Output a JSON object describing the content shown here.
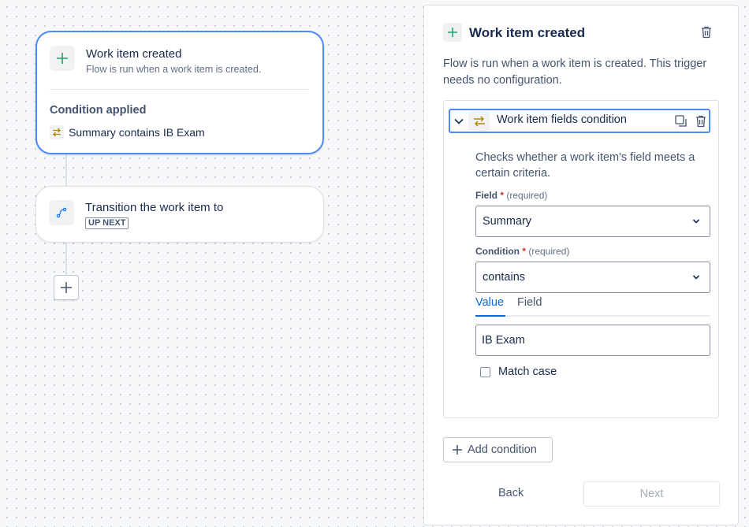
{
  "canvas": {
    "trigger_card": {
      "title": "Work item created",
      "subtitle": "Flow is run when a work item is created.",
      "condition_heading": "Condition applied",
      "condition_text": "Summary contains IB Exam"
    },
    "action_card": {
      "title": "Transition the work item to",
      "status": "UP NEXT"
    },
    "add_step_icon": "plus-icon"
  },
  "panel": {
    "title": "Work item created",
    "description": "Flow is run when a work item is created. This trigger needs no configuration.",
    "condition": {
      "header_label": "Work item fields condition",
      "description": "Checks whether a work item's field meets a certain criteria.",
      "field_label": "Field",
      "field_required_star": "*",
      "field_required_note": "(required)",
      "field_value": "Summary",
      "condition_label": "Condition",
      "condition_required_star": "*",
      "condition_required_note": "(required)",
      "condition_value": "contains",
      "tabs": [
        "Value",
        "Field"
      ],
      "active_tab": "Value",
      "value_input": "IB Exam",
      "match_case_label": "Match case",
      "match_case_checked": false
    },
    "add_condition_label": "Add condition",
    "back_label": "Back",
    "next_label": "Next"
  },
  "colors": {
    "accent": "#4c8bf5",
    "link": "#0c66e4",
    "required": "#c9372c",
    "trigger_icon": "#22a06b",
    "condition_icon": "#b38600"
  }
}
